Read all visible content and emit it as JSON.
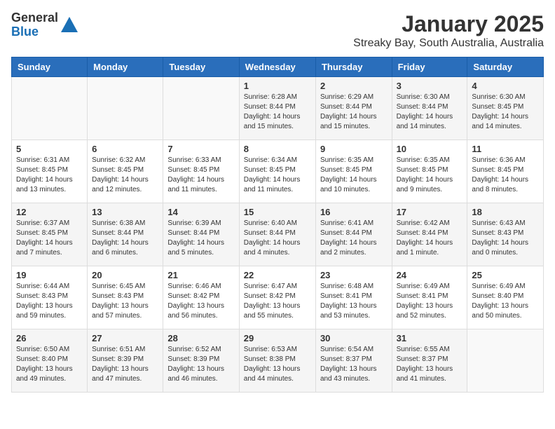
{
  "header": {
    "logo_general": "General",
    "logo_blue": "Blue",
    "month_title": "January 2025",
    "location": "Streaky Bay, South Australia, Australia"
  },
  "weekdays": [
    "Sunday",
    "Monday",
    "Tuesday",
    "Wednesday",
    "Thursday",
    "Friday",
    "Saturday"
  ],
  "weeks": [
    [
      {
        "day": "",
        "info": ""
      },
      {
        "day": "",
        "info": ""
      },
      {
        "day": "",
        "info": ""
      },
      {
        "day": "1",
        "info": "Sunrise: 6:28 AM\nSunset: 8:44 PM\nDaylight: 14 hours\nand 15 minutes."
      },
      {
        "day": "2",
        "info": "Sunrise: 6:29 AM\nSunset: 8:44 PM\nDaylight: 14 hours\nand 15 minutes."
      },
      {
        "day": "3",
        "info": "Sunrise: 6:30 AM\nSunset: 8:44 PM\nDaylight: 14 hours\nand 14 minutes."
      },
      {
        "day": "4",
        "info": "Sunrise: 6:30 AM\nSunset: 8:45 PM\nDaylight: 14 hours\nand 14 minutes."
      }
    ],
    [
      {
        "day": "5",
        "info": "Sunrise: 6:31 AM\nSunset: 8:45 PM\nDaylight: 14 hours\nand 13 minutes."
      },
      {
        "day": "6",
        "info": "Sunrise: 6:32 AM\nSunset: 8:45 PM\nDaylight: 14 hours\nand 12 minutes."
      },
      {
        "day": "7",
        "info": "Sunrise: 6:33 AM\nSunset: 8:45 PM\nDaylight: 14 hours\nand 11 minutes."
      },
      {
        "day": "8",
        "info": "Sunrise: 6:34 AM\nSunset: 8:45 PM\nDaylight: 14 hours\nand 11 minutes."
      },
      {
        "day": "9",
        "info": "Sunrise: 6:35 AM\nSunset: 8:45 PM\nDaylight: 14 hours\nand 10 minutes."
      },
      {
        "day": "10",
        "info": "Sunrise: 6:35 AM\nSunset: 8:45 PM\nDaylight: 14 hours\nand 9 minutes."
      },
      {
        "day": "11",
        "info": "Sunrise: 6:36 AM\nSunset: 8:45 PM\nDaylight: 14 hours\nand 8 minutes."
      }
    ],
    [
      {
        "day": "12",
        "info": "Sunrise: 6:37 AM\nSunset: 8:45 PM\nDaylight: 14 hours\nand 7 minutes."
      },
      {
        "day": "13",
        "info": "Sunrise: 6:38 AM\nSunset: 8:44 PM\nDaylight: 14 hours\nand 6 minutes."
      },
      {
        "day": "14",
        "info": "Sunrise: 6:39 AM\nSunset: 8:44 PM\nDaylight: 14 hours\nand 5 minutes."
      },
      {
        "day": "15",
        "info": "Sunrise: 6:40 AM\nSunset: 8:44 PM\nDaylight: 14 hours\nand 4 minutes."
      },
      {
        "day": "16",
        "info": "Sunrise: 6:41 AM\nSunset: 8:44 PM\nDaylight: 14 hours\nand 2 minutes."
      },
      {
        "day": "17",
        "info": "Sunrise: 6:42 AM\nSunset: 8:44 PM\nDaylight: 14 hours\nand 1 minute."
      },
      {
        "day": "18",
        "info": "Sunrise: 6:43 AM\nSunset: 8:43 PM\nDaylight: 14 hours\nand 0 minutes."
      }
    ],
    [
      {
        "day": "19",
        "info": "Sunrise: 6:44 AM\nSunset: 8:43 PM\nDaylight: 13 hours\nand 59 minutes."
      },
      {
        "day": "20",
        "info": "Sunrise: 6:45 AM\nSunset: 8:43 PM\nDaylight: 13 hours\nand 57 minutes."
      },
      {
        "day": "21",
        "info": "Sunrise: 6:46 AM\nSunset: 8:42 PM\nDaylight: 13 hours\nand 56 minutes."
      },
      {
        "day": "22",
        "info": "Sunrise: 6:47 AM\nSunset: 8:42 PM\nDaylight: 13 hours\nand 55 minutes."
      },
      {
        "day": "23",
        "info": "Sunrise: 6:48 AM\nSunset: 8:41 PM\nDaylight: 13 hours\nand 53 minutes."
      },
      {
        "day": "24",
        "info": "Sunrise: 6:49 AM\nSunset: 8:41 PM\nDaylight: 13 hours\nand 52 minutes."
      },
      {
        "day": "25",
        "info": "Sunrise: 6:49 AM\nSunset: 8:40 PM\nDaylight: 13 hours\nand 50 minutes."
      }
    ],
    [
      {
        "day": "26",
        "info": "Sunrise: 6:50 AM\nSunset: 8:40 PM\nDaylight: 13 hours\nand 49 minutes."
      },
      {
        "day": "27",
        "info": "Sunrise: 6:51 AM\nSunset: 8:39 PM\nDaylight: 13 hours\nand 47 minutes."
      },
      {
        "day": "28",
        "info": "Sunrise: 6:52 AM\nSunset: 8:39 PM\nDaylight: 13 hours\nand 46 minutes."
      },
      {
        "day": "29",
        "info": "Sunrise: 6:53 AM\nSunset: 8:38 PM\nDaylight: 13 hours\nand 44 minutes."
      },
      {
        "day": "30",
        "info": "Sunrise: 6:54 AM\nSunset: 8:37 PM\nDaylight: 13 hours\nand 43 minutes."
      },
      {
        "day": "31",
        "info": "Sunrise: 6:55 AM\nSunset: 8:37 PM\nDaylight: 13 hours\nand 41 minutes."
      },
      {
        "day": "",
        "info": ""
      }
    ]
  ]
}
